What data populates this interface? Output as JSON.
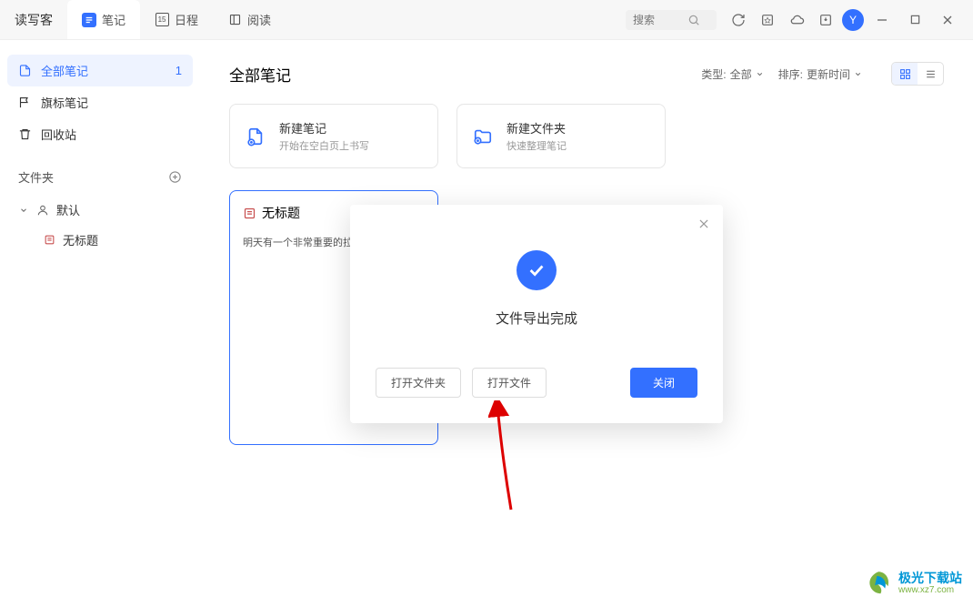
{
  "app": {
    "name": "读写客"
  },
  "tabs": {
    "notes": "笔记",
    "calendar": "日程",
    "calendar_day": "15",
    "reading": "阅读"
  },
  "search": {
    "placeholder": "搜索"
  },
  "avatar_letter": "Y",
  "sidebar": {
    "all_notes": "全部笔记",
    "all_count": "1",
    "flag_notes": "旗标笔记",
    "trash": "回收站",
    "folders_label": "文件夹",
    "default_folder": "默认",
    "untitled": "无标题"
  },
  "content": {
    "title": "全部笔记",
    "type_label": "类型:",
    "type_value": "全部",
    "sort_label": "排序:",
    "sort_value": "更新时间"
  },
  "cards": {
    "new_note_title": "新建笔记",
    "new_note_sub": "开始在空白页上书写",
    "new_folder_title": "新建文件夹",
    "new_folder_sub": "快速整理笔记"
  },
  "note": {
    "title": "无标题",
    "body": "明天有一个非常重要的拉"
  },
  "modal": {
    "message": "文件导出完成",
    "open_folder": "打开文件夹",
    "open_file": "打开文件",
    "close": "关闭"
  },
  "watermark": {
    "main": "极光下载站",
    "sub": "www.xz7.com"
  }
}
